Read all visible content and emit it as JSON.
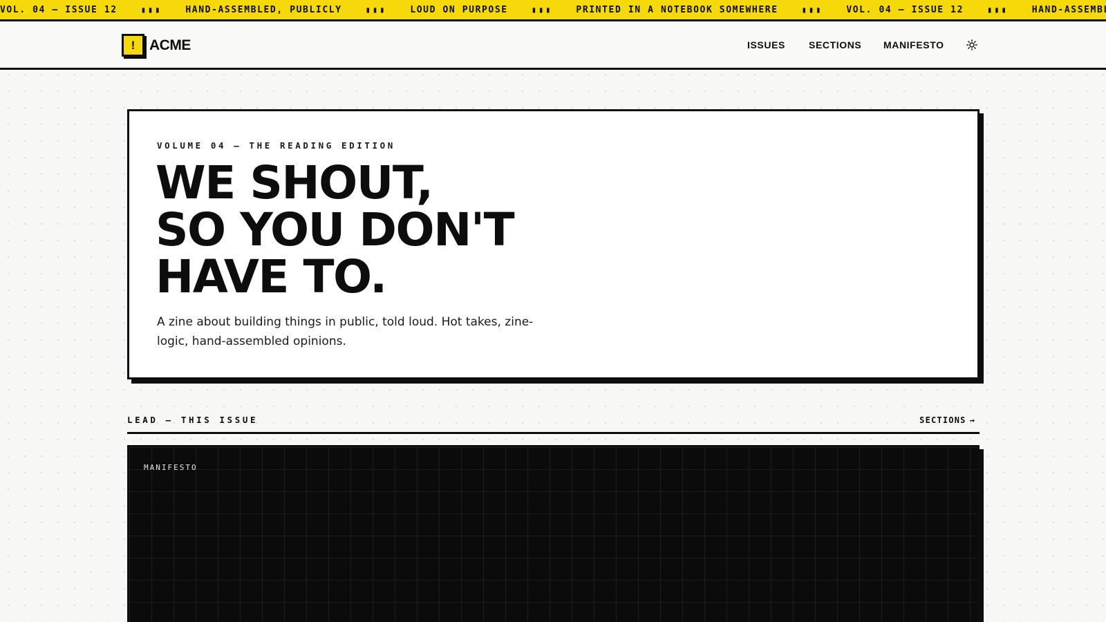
{
  "ticker": {
    "items": [
      "VOL. 04 — ISSUE 12",
      "HAND-ASSEMBLED, PUBLICLY",
      "LOUD ON PURPOSE",
      "PRINTED IN A NOTEBOOK SOMEWHERE",
      "VOL. 04 — ISSUE 12",
      "HAND-ASSEMBLED, PUBLICLY"
    ],
    "separator": "▮▮▮"
  },
  "header": {
    "logo_mark": "!",
    "logo_text": "ACME",
    "nav": [
      "ISSUES",
      "SECTIONS",
      "MANIFESTO"
    ],
    "theme_icon": "sun-icon"
  },
  "hero": {
    "kicker": "VOLUME 04 — THE READING EDITION",
    "title_lines": [
      "WE SHOUT,",
      "SO YOU DON'T",
      "HAVE TO."
    ],
    "subtitle": "A zine about building things in public, told loud. Hot takes, zine-logic, hand-assembled opinions."
  },
  "lead": {
    "label": "LEAD — THIS ISSUE",
    "sections_link": "SECTIONS",
    "sections_arrow": "→",
    "card_tag": "MANIFESTO"
  },
  "colors": {
    "accent": "#f5d90a",
    "ink": "#0d0d0d",
    "paper": "#f7f7f5",
    "card_dark": "#0b0b0b"
  }
}
